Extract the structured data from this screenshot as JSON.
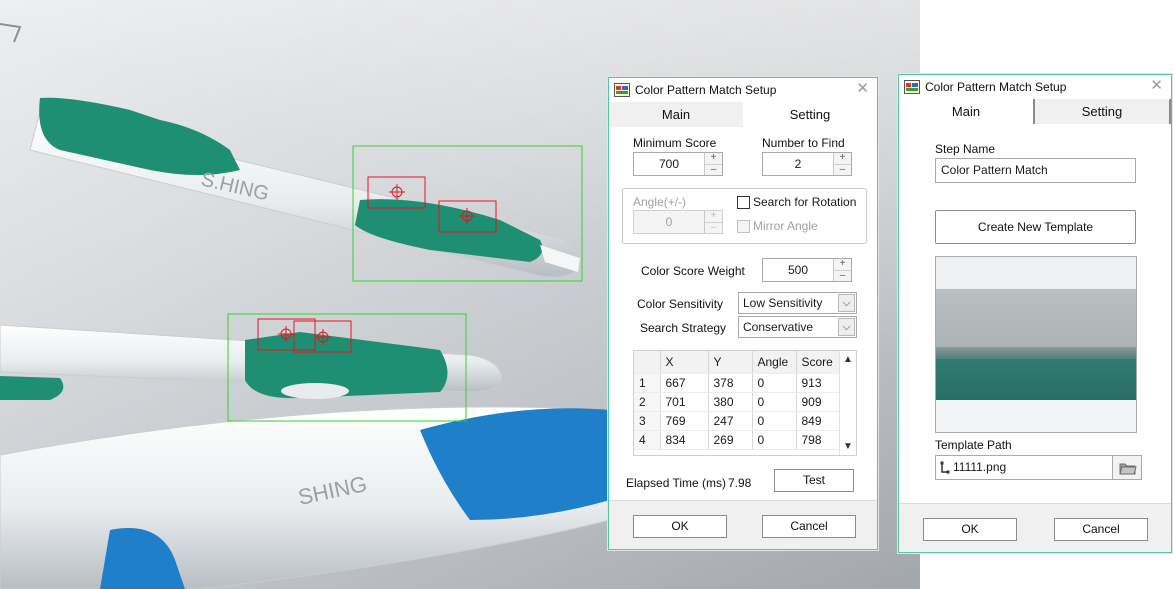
{
  "colors": {
    "accent_border": "#53c7a6",
    "detection_box_green": "#2dd62d",
    "match_box_red": "#e2161f",
    "pen_green": "#1e8f72",
    "pen_blue": "#1f7fc8"
  },
  "camera": {
    "image_text_1": "S.HING",
    "image_text_2": "SHING"
  },
  "dialog1": {
    "title": "Color Pattern Match Setup",
    "app_icon": "labview-vi-icon",
    "tabs": [
      {
        "label": "Main"
      },
      {
        "label": "Setting"
      }
    ],
    "active_tab": "Setting",
    "minimum_score": {
      "label": "Minimum Score",
      "value": "700"
    },
    "number_to_find": {
      "label": "Number to Find",
      "value": "2"
    },
    "angle": {
      "label": "Angle(+/-)",
      "value": "0"
    },
    "search_for_rotation": {
      "label": "Search for Rotation",
      "checked": false
    },
    "mirror_angle": {
      "label": "Mirror Angle",
      "checked": false
    },
    "color_score_weight": {
      "label": "Color Score Weight",
      "value": "500"
    },
    "color_sensitivity": {
      "label": "Color Sensitivity",
      "value": "Low Sensitivity"
    },
    "search_strategy": {
      "label": "Search Strategy",
      "value": "Conservative"
    },
    "table": {
      "columns": [
        "X",
        "Y",
        "Angle",
        "Score"
      ],
      "rows": [
        {
          "n": "1",
          "x": "667",
          "y": "378",
          "angle": "0",
          "score": "913"
        },
        {
          "n": "2",
          "x": "701",
          "y": "380",
          "angle": "0",
          "score": "909"
        },
        {
          "n": "3",
          "x": "769",
          "y": "247",
          "angle": "0",
          "score": "849"
        },
        {
          "n": "4",
          "x": "834",
          "y": "269",
          "angle": "0",
          "score": "798"
        }
      ]
    },
    "elapsed_label": "Elapsed Time (ms)",
    "elapsed_value": "7.98",
    "test_label": "Test",
    "ok_label": "OK",
    "cancel_label": "Cancel"
  },
  "dialog2": {
    "title": "Color Pattern Match Setup",
    "tabs": [
      {
        "label": "Main"
      },
      {
        "label": "Setting"
      }
    ],
    "active_tab": "Main",
    "step_name_label": "Step Name",
    "step_name_value": "Color Pattern Match",
    "create_template_label": "Create New Template",
    "template_path_label": "Template Path",
    "template_path_value": "11111.png",
    "ok_label": "OK",
    "cancel_label": "Cancel"
  }
}
